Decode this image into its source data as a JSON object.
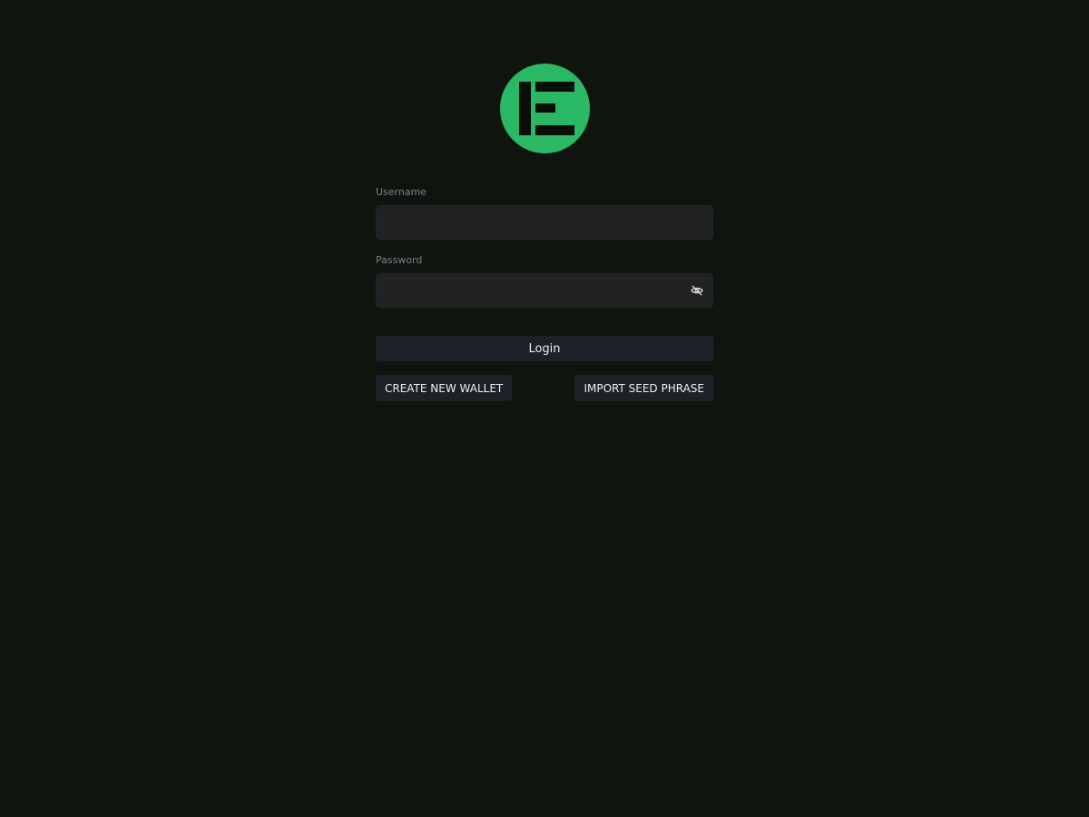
{
  "colors": {
    "background": "#0f140f",
    "brand_green": "#2bb865",
    "input_bg": "#212223",
    "button_bg": "#1f2128",
    "label_text": "#7d828a"
  },
  "logo": {
    "icon": "e-logo-icon"
  },
  "form": {
    "username": {
      "label": "Username",
      "value": "",
      "placeholder": ""
    },
    "password": {
      "label": "Password",
      "value": "",
      "placeholder": "",
      "toggle_icon": "eye-off-icon"
    },
    "login_label": "Login"
  },
  "actions": {
    "create_wallet_label": "CREATE NEW WALLET",
    "import_seed_label": "IMPORT SEED PHRASE"
  }
}
